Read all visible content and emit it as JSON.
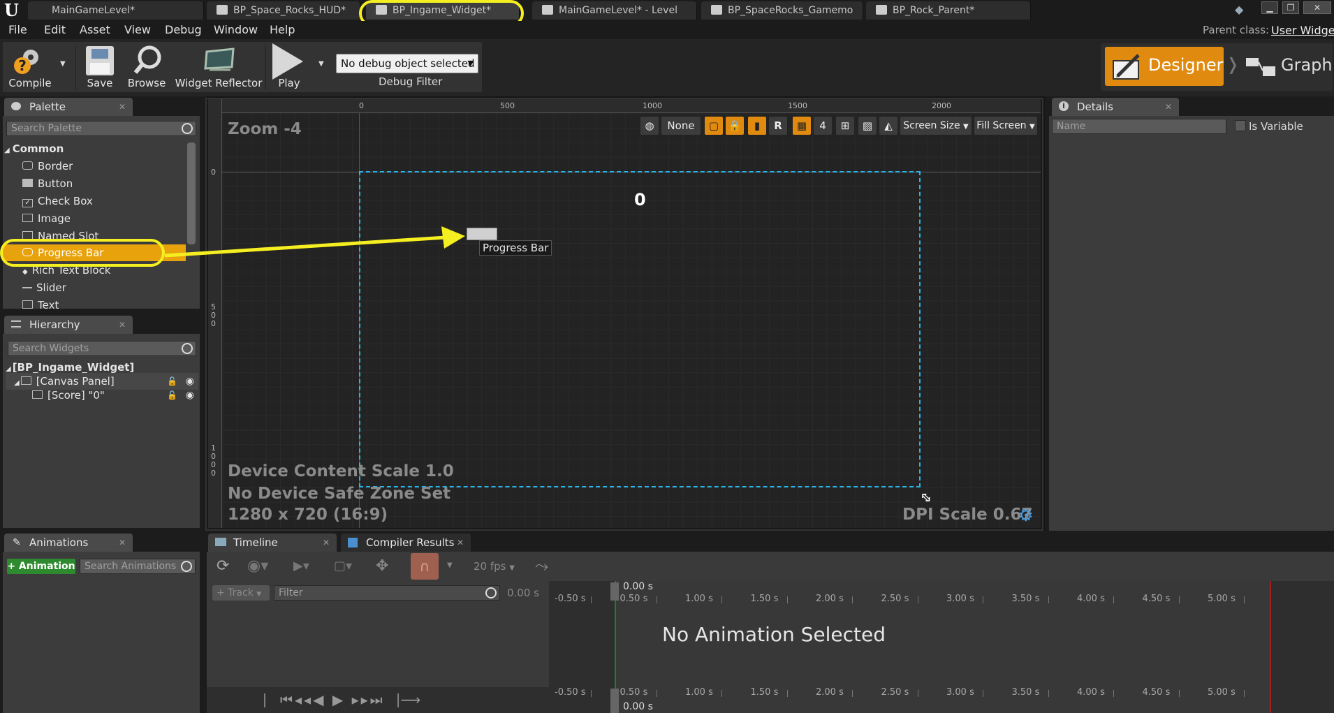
{
  "window": {
    "tabs": [
      {
        "label": "MainGameLevel*"
      },
      {
        "label": "BP_Space_Rocks_HUD*"
      },
      {
        "label": "BP_Ingame_Widget*"
      },
      {
        "label": "MainGameLevel* - Level"
      },
      {
        "label": "BP_SpaceRocks_Gamemo"
      },
      {
        "label": "BP_Rock_Parent*"
      }
    ],
    "controls": {
      "minimize": "▁",
      "restore": "❐",
      "close": "✕"
    }
  },
  "menubar": {
    "items": [
      "File",
      "Edit",
      "Asset",
      "View",
      "Debug",
      "Window",
      "Help"
    ],
    "parent_class_label": "Parent class:",
    "parent_class_value": "User Widget"
  },
  "toolbar": {
    "compile": "Compile",
    "save": "Save",
    "browse": "Browse",
    "widget_reflector": "Widget Reflector",
    "play": "Play",
    "debug_select": "No debug object selected",
    "debug_filter": "Debug Filter",
    "designer": "Designer",
    "graph": "Graph",
    "accent_color": "#e08a10"
  },
  "palette": {
    "title": "Palette",
    "search_placeholder": "Search Palette",
    "category": "Common",
    "items": [
      "Border",
      "Button",
      "Check Box",
      "Image",
      "Named Slot",
      "Progress Bar",
      "Rich Text Block",
      "Slider",
      "Text"
    ],
    "highlight_color": "#e8a20c"
  },
  "hierarchy": {
    "title": "Hierarchy",
    "search_placeholder": "Search Widgets",
    "root": "[BP_Ingame_Widget]",
    "canvas": "[Canvas Panel]",
    "score": "[Score] \"0\""
  },
  "designer": {
    "zoom": "Zoom -4",
    "ruler_top": [
      "0",
      "500",
      "1000",
      "1500",
      "2000"
    ],
    "ruler_left": [
      "0",
      "5\n0\n0",
      "1\n0\n0\n0"
    ],
    "score_text": "0",
    "progress_tooltip": "Progress Bar",
    "device_scale": "Device Content Scale 1.0",
    "safe_zone": "No Device Safe Zone Set",
    "resolution": "1280 x 720 (16:9)",
    "dpi": "DPI Scale 0.67",
    "viewport_buttons": {
      "none": "None",
      "r": "R",
      "grid": "4",
      "screen_size": "Screen Size",
      "fill_screen": "Fill Screen"
    },
    "frame_color": "#2ab4e8",
    "annotation_color": "#f5ee20"
  },
  "details": {
    "title": "Details",
    "name_placeholder": "Name",
    "is_variable": "Is Variable"
  },
  "animations": {
    "title": "Animations",
    "add_button": "+ Animation",
    "search_placeholder": "Search Animations"
  },
  "timeline": {
    "tab_timeline": "Timeline",
    "tab_compiler": "Compiler Results",
    "fps": "20 fps",
    "track_button": "+ Track",
    "filter_placeholder": "Filter",
    "time_value": "0.00 s",
    "current_time": "0.00 s",
    "empty_text": "No Animation Selected",
    "ticks": [
      "-0.50 s",
      "0.50 s",
      "1.00 s",
      "1.50 s",
      "2.00 s",
      "2.50 s",
      "3.00 s",
      "3.50 s",
      "4.00 s",
      "4.50 s",
      "5.00 s"
    ]
  }
}
